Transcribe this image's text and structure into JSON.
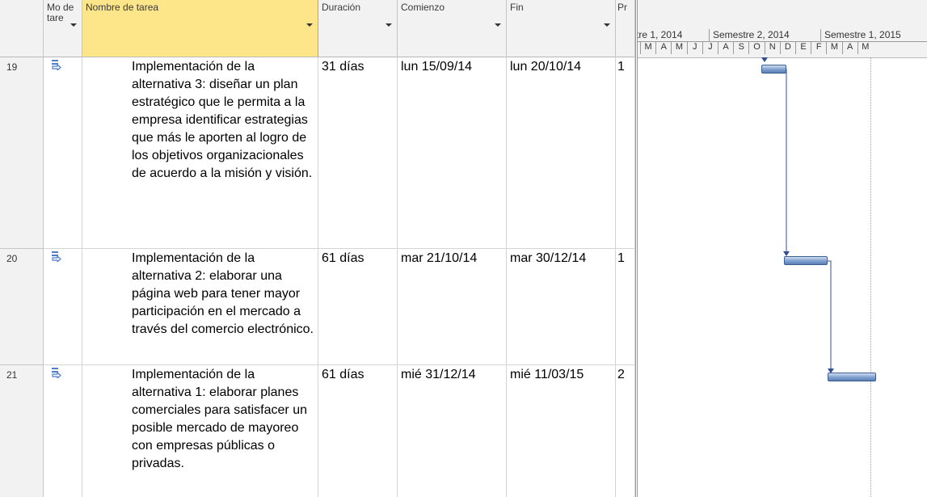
{
  "columns": {
    "mode": "Mo de tare",
    "name": "Nombre de tarea",
    "duration": "Duración",
    "start": "Comienzo",
    "finish": "Fin",
    "pred": "Pr"
  },
  "rows": [
    {
      "id": "19",
      "name": "Implementación de la alternativa 3: diseñar un plan estratégico que le permita a la empresa identificar estrategias que más le aporten al logro de los objetivos organizacionales de acuerdo a la misión y visión.",
      "duration": "31 días",
      "start": "lun 15/09/14",
      "finish": "lun 20/10/14",
      "pred": "1"
    },
    {
      "id": "20",
      "name": "Implementación de la alternativa 2: elaborar una página web para tener mayor participación en el mercado a través del comercio electrónico.",
      "duration": "61 días",
      "start": "mar 21/10/14",
      "finish": "mar 30/12/14",
      "pred": "1"
    },
    {
      "id": "21",
      "name": "Implementación de la alternativa 1: elaborar planes comerciales para satisfacer un posible mercado de mayoreo con empresas públicas o privadas.",
      "duration": "61 días",
      "start": "mié 31/12/14",
      "finish": "mié 11/03/15",
      "pred": "2"
    }
  ],
  "timescale": {
    "top": [
      "tre 1, 2014",
      "Semestre 2, 2014",
      "Semestre 1, 2015"
    ],
    "bottom": [
      "M",
      "A",
      "M",
      "J",
      "J",
      "A",
      "S",
      "O",
      "N",
      "D",
      "E",
      "F",
      "M",
      "A",
      "M"
    ]
  },
  "colors": {
    "header_selected": "#fde58a",
    "bar": "#6f8fc4",
    "link": "#2f4f8f"
  }
}
